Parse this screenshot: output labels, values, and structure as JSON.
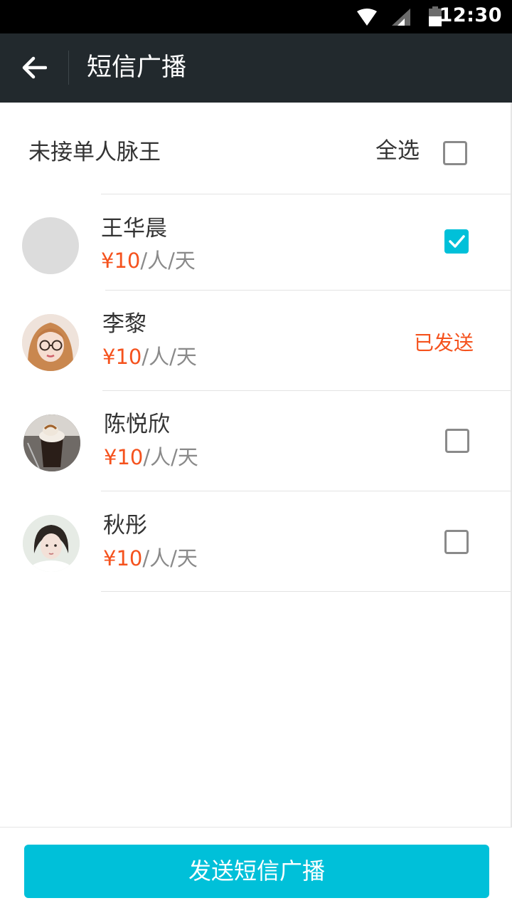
{
  "status_bar": {
    "time": "12:30",
    "icons": [
      "wifi-icon",
      "signal-icon",
      "battery-icon"
    ]
  },
  "app_bar": {
    "title": "短信广播",
    "back_icon": "back-arrow-icon"
  },
  "group": {
    "title": "未接单人脉王",
    "select_all_label": "全选",
    "select_all_checked": false
  },
  "contacts": [
    {
      "name": "王华晨",
      "price": "¥10",
      "unit": "/人/天",
      "state": "checked"
    },
    {
      "name": "李黎",
      "price": "¥10",
      "unit": "/人/天",
      "state": "sent",
      "sent_label": "已发送"
    },
    {
      "name": "陈悦欣",
      "price": "¥10",
      "unit": "/人/天",
      "state": "unchecked"
    },
    {
      "name": "秋彤",
      "price": "¥10",
      "unit": "/人/天",
      "state": "unchecked"
    }
  ],
  "send_button": {
    "label": "发送短信广播"
  },
  "colors": {
    "accent": "#00c0d9",
    "price": "#f5521d",
    "app_bar": "#22292d",
    "status_bar": "#000000"
  }
}
